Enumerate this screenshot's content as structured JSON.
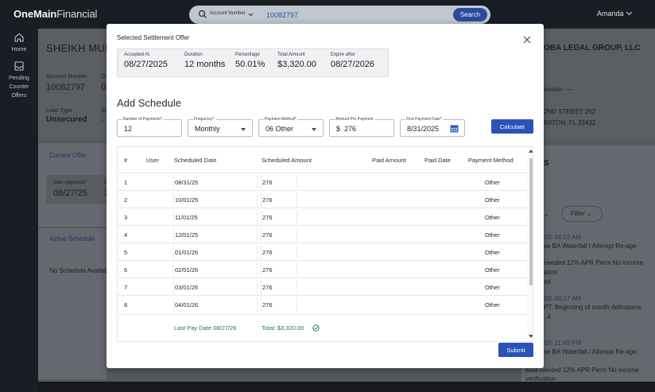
{
  "app": {
    "logo_bold": "OneMain",
    "logo_light": "Financial"
  },
  "search": {
    "type_label": "Account Number",
    "value": "10082797",
    "button": "Search"
  },
  "user": {
    "name": "Amanda"
  },
  "nav": [
    {
      "label": "Home",
      "icon": "home-icon"
    },
    {
      "label": "Pending Counter Offers",
      "icon": "inbox-icon"
    }
  ],
  "background": {
    "customer_name": "SHEIKH MUH",
    "account_label": "Account Number",
    "account_value": "10082797",
    "account_trunc": "0",
    "loan_type_label": "Loan Type",
    "loan_type_value": "Unsecured",
    "loan_type_trunc": "At",
    "loan_type_trunc_val": "-",
    "col_d": "D",
    "current_offer": "Current Offer",
    "date_approved_label": "Date Approved",
    "date_approved_value": "08/27/25",
    "approved_trunc_label": "D",
    "approved_trunc_value": "1",
    "active_schedule": "Active Schedule",
    "no_schedule": "No Schedule Availab",
    "firm": "OBA LEGAL GROUP, LLC",
    "extension": "ension ----",
    "address1": "2ND STREET 252",
    "address2": "RATON, FL 33432",
    "letter_s": "S",
    "filter": "Filter",
    "activity": [
      {
        "date": "/25 04:52 AM",
        "line1": "se BA Waterfall / Attempt Re-age",
        "line2": "needed 12% APR Perm No income",
        "line3": "ation",
        "line4": "ed"
      },
      {
        "date": "/25 08:17 AM",
        "line1": "PT: Beginning of month delinquenc",
        "line2": ": 4"
      },
      {
        "date": "/25 11:49 PM",
        "line1": "se BA Waterfall / Attempt Re-age",
        "line2": "Mod needed 12% APR Perm No income",
        "line3": "verification"
      }
    ]
  },
  "modal": {
    "title": "Selected Settlement Offer",
    "offer": [
      {
        "label": "Accepted At",
        "value": "08/27/2025"
      },
      {
        "label": "Duration",
        "value": "12 months"
      },
      {
        "label": "Percentage",
        "value": "50.01%"
      },
      {
        "label": "Total Amount",
        "value": "$3,320.00"
      },
      {
        "label": "Expire after",
        "value": "08/27/2026"
      }
    ],
    "schedule_title": "Add Schedule",
    "fields": {
      "num_payments": {
        "label": "Number of Payments",
        "value": "12"
      },
      "frequency": {
        "label": "Frequency",
        "value": "Monthly"
      },
      "payment_method": {
        "label": "Payment Method",
        "value": "06 Other"
      },
      "amount": {
        "label": "Amount Per Payment",
        "prefix": "$",
        "value": "276"
      },
      "first_date": {
        "label": "First Payment Date",
        "value": "8/31/2025"
      }
    },
    "required_mark": "*",
    "calculate": "Calculate",
    "submit": "Submit",
    "grid": {
      "headers": [
        "#",
        "User",
        "Scheduled Date",
        "Scheduled Amount",
        "Paid Amount",
        "Paid Date",
        "Payment Method"
      ],
      "rows": [
        {
          "n": "1",
          "date": "08/31/25",
          "amount": "276",
          "method": "Other"
        },
        {
          "n": "2",
          "date": "10/01/25",
          "amount": "276",
          "method": "Other"
        },
        {
          "n": "3",
          "date": "11/01/25",
          "amount": "276",
          "method": "Other"
        },
        {
          "n": "4",
          "date": "12/01/25",
          "amount": "276",
          "method": "Other"
        },
        {
          "n": "5",
          "date": "01/01/26",
          "amount": "276",
          "method": "Other"
        },
        {
          "n": "6",
          "date": "02/01/26",
          "amount": "276",
          "method": "Other"
        },
        {
          "n": "7",
          "date": "03/01/26",
          "amount": "276",
          "method": "Other"
        },
        {
          "n": "8",
          "date": "04/01/26",
          "amount": "276",
          "method": "Other"
        }
      ],
      "last_pay": "Last Pay Date 08/27/26",
      "total": "Total: $3,320.00"
    }
  },
  "colors": {
    "primary": "#2a52b8",
    "success": "#1f7a3a",
    "topbar": "#1b2026"
  }
}
